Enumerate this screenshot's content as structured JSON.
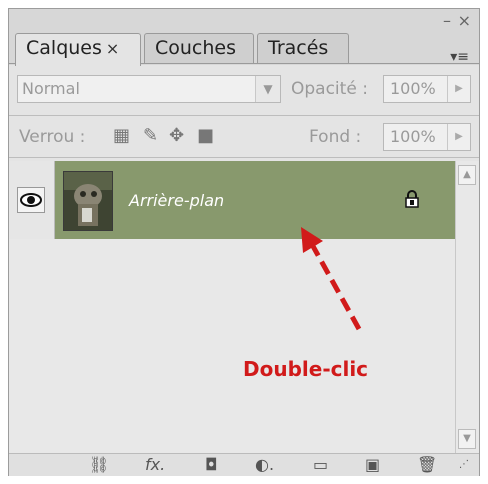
{
  "window": {
    "minimize": "–",
    "close": "×",
    "menu": "▾≡"
  },
  "tabs": [
    {
      "label": "Calques",
      "close": "×",
      "active": true
    },
    {
      "label": "Couches",
      "active": false
    },
    {
      "label": "Tracés",
      "active": false
    }
  ],
  "blend_mode": {
    "value": "Normal"
  },
  "opacity": {
    "label": "Opacité :",
    "value": "100%"
  },
  "lock": {
    "label": "Verrou :"
  },
  "fill": {
    "label": "Fond :",
    "value": "100%"
  },
  "layers": [
    {
      "name": "Arrière-plan",
      "visible": true,
      "locked": true,
      "selected": true
    }
  ],
  "annotation": {
    "text": "Double-clic",
    "color": "#d11a1a"
  },
  "colors": {
    "selected_layer": "#88996d",
    "panel_bg": "#e4e4e4"
  }
}
